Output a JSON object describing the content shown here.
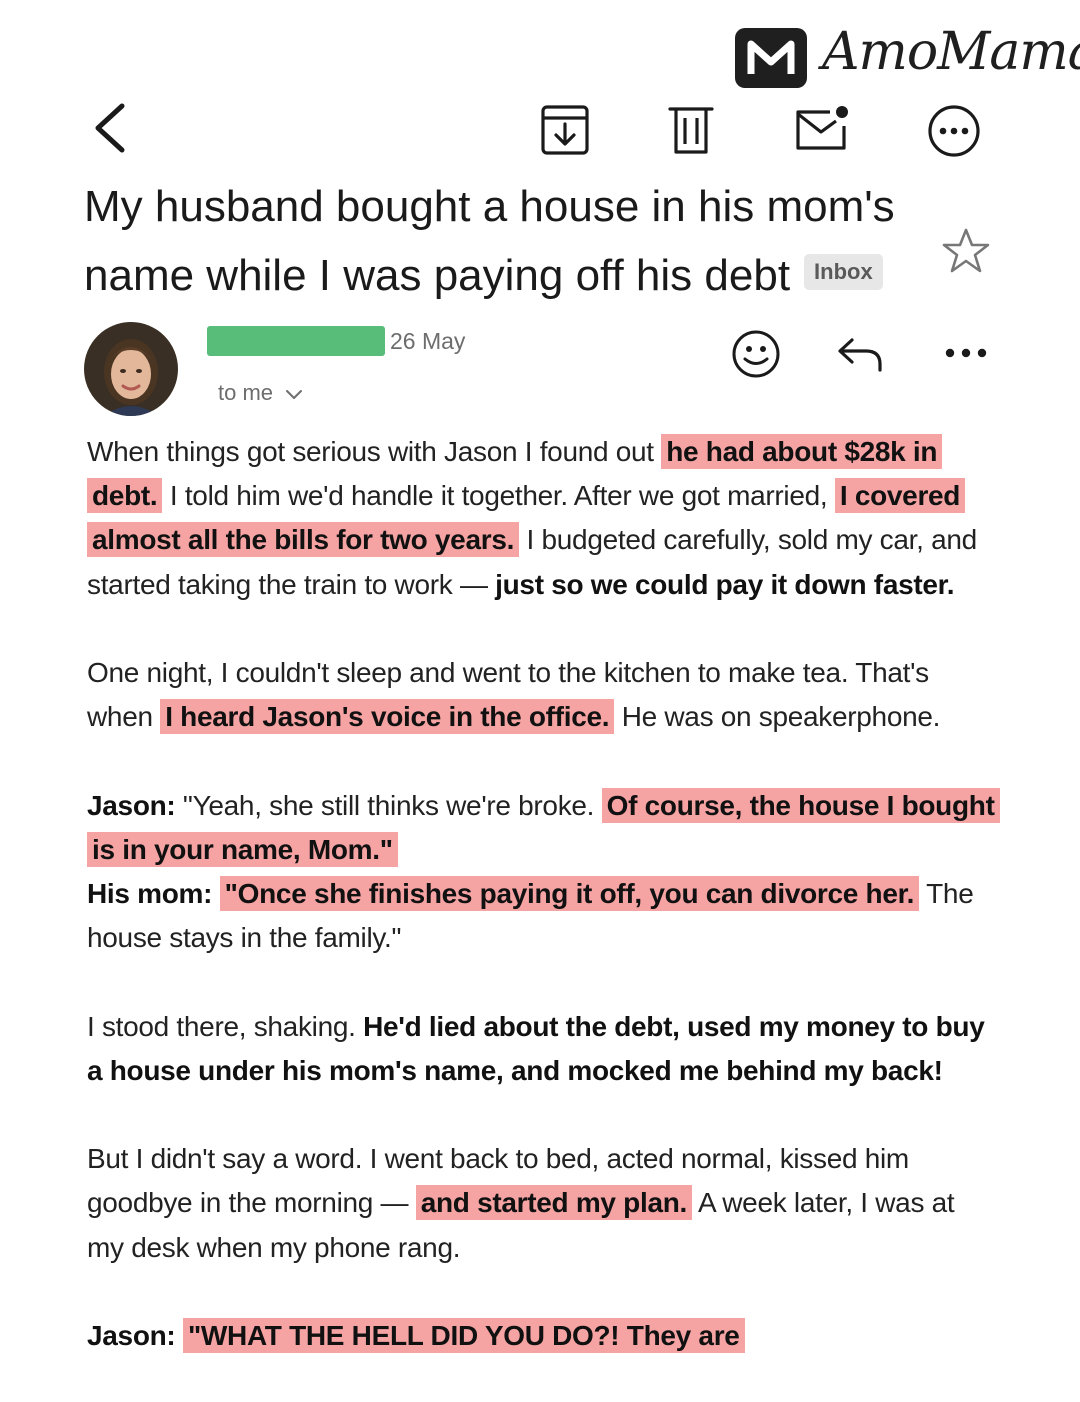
{
  "brand": {
    "name": "AmoMama",
    "logo_icon": "amomama-m-logo-icon"
  },
  "toolbar": {
    "back": "back-arrow-icon",
    "archive": "archive-icon",
    "delete": "trash-icon",
    "mark_unread": "mark-unread-icon",
    "more": "more-circle-icon"
  },
  "email": {
    "subject": "My husband bought a house in his mom's name while I was paying off his debt",
    "label": "Inbox",
    "sender_redacted_color": "#58bd79",
    "date": "26 May",
    "to": "to me",
    "actions": [
      "emoji-react-icon",
      "reply-icon",
      "more-dots-icon"
    ]
  },
  "body": {
    "p1": {
      "t1": "When things got serious with Jason I found out ",
      "h1": "he had about $28k in debt.",
      "t2": " I told him we'd handle it together. After we got married, ",
      "h2": "I covered almost all the bills for two years.",
      "t3": " I budgeted carefully, sold my car, and started taking the train to work — ",
      "b1": "just so we could pay it down faster."
    },
    "p2": {
      "t1": "One night, I couldn't sleep and went to the kitchen to make tea. That's when ",
      "h1": "I heard Jason's voice in the office.",
      "t2": " He was on speakerphone."
    },
    "p3": {
      "speaker1": "Jason:",
      "t1": " \"Yeah, she still thinks we're broke. ",
      "h1": "Of course, the house I bought is in your name, Mom.\"",
      "speaker2": "His mom:",
      "h2": "\"Once she finishes paying it off, you can divorce her.",
      "t2": " The house stays in the family.\""
    },
    "p4": {
      "t1": "I stood there, shaking. ",
      "b1": "He'd lied about the debt, used my money to buy a house under his mom's name, and mocked me behind my back!"
    },
    "p5": {
      "t1": "But I didn't say a word. I went back to bed, acted normal, kissed him goodbye in the morning — ",
      "h1": "and started my plan.",
      "t2": " A week later, I was at my desk when my phone rang."
    },
    "p6": {
      "speaker": "Jason:",
      "h1": "\"WHAT THE HELL DID YOU DO?! They are"
    }
  },
  "colors": {
    "highlight": "#f5a3a3",
    "text": "#222222",
    "muted": "#6d6d6d"
  }
}
